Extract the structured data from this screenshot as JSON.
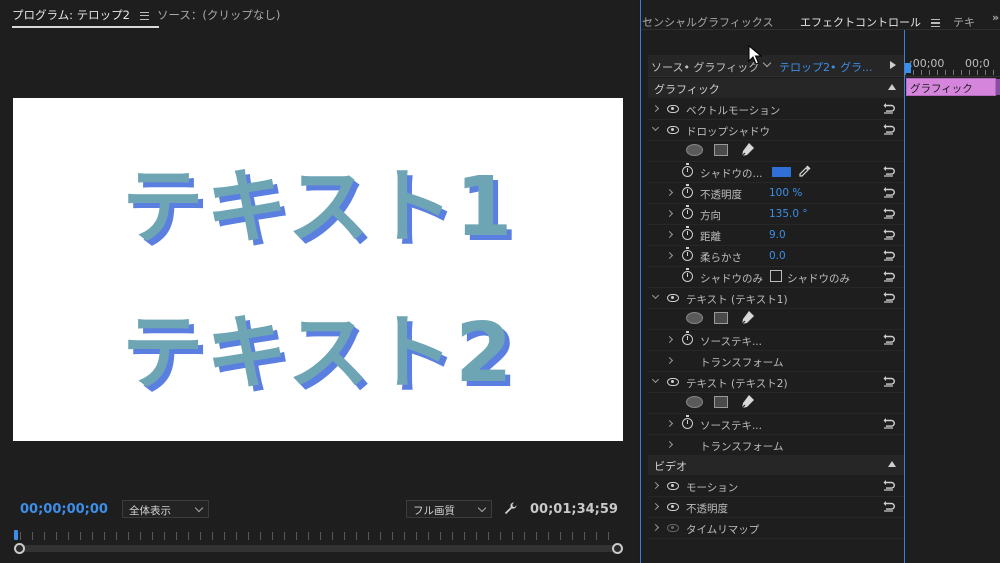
{
  "program": {
    "tab_program": "プログラム: テロップ2",
    "tab_source": "ソース：(クリップなし)",
    "preview_text_1": "テキスト1",
    "preview_text_2": "テキスト2",
    "timecode_current": "00;00;00;00",
    "zoom_value": "全体表示",
    "quality_value": "フル画質",
    "timecode_duration": "00;01;34;59"
  },
  "effects": {
    "tab_essential": "センシャルグラフィックス",
    "tab_effect_controls": "エフェクトコントロール",
    "tab_text": "テキ",
    "tab_more": "»",
    "source_label": "ソース• グラフィック",
    "sequence_label": "テロップ2• グラ...",
    "section_graphic": "グラフィック",
    "vector_motion": "ベクトルモーション",
    "drop_shadow": "ドロップシャドウ",
    "shadow_color": "シャドウの...",
    "opacity_label": "不透明度",
    "opacity_value": "100 %",
    "direction_label": "方向",
    "direction_value": "135.0 °",
    "distance_label": "距離",
    "distance_value": "9.0",
    "softness_label": "柔らかさ",
    "softness_value": "0.0",
    "shadow_only_label": "シャドウのみ",
    "shadow_only_checkbox": "シャドウのみ",
    "text_layer_1": "テキスト (テキスト1)",
    "source_text_1": "ソーステキ...",
    "transform_1": "トランスフォーム",
    "text_layer_2": "テキスト (テキスト2)",
    "source_text_2": "ソーステキ...",
    "transform_2": "トランスフォーム",
    "section_video": "ビデオ",
    "motion": "モーション",
    "video_opacity": "不透明度",
    "time_remap": "タイムリマップ"
  },
  "mini_timeline": {
    "tc_1": ";00;00",
    "tc_2": "00;0",
    "clip_label": "グラフィック"
  },
  "colors": {
    "accent": "#3d8ee6",
    "clip": "#d586dc",
    "text_fill": "#6ea5b5",
    "text_shadow": "#5b7fe0"
  }
}
